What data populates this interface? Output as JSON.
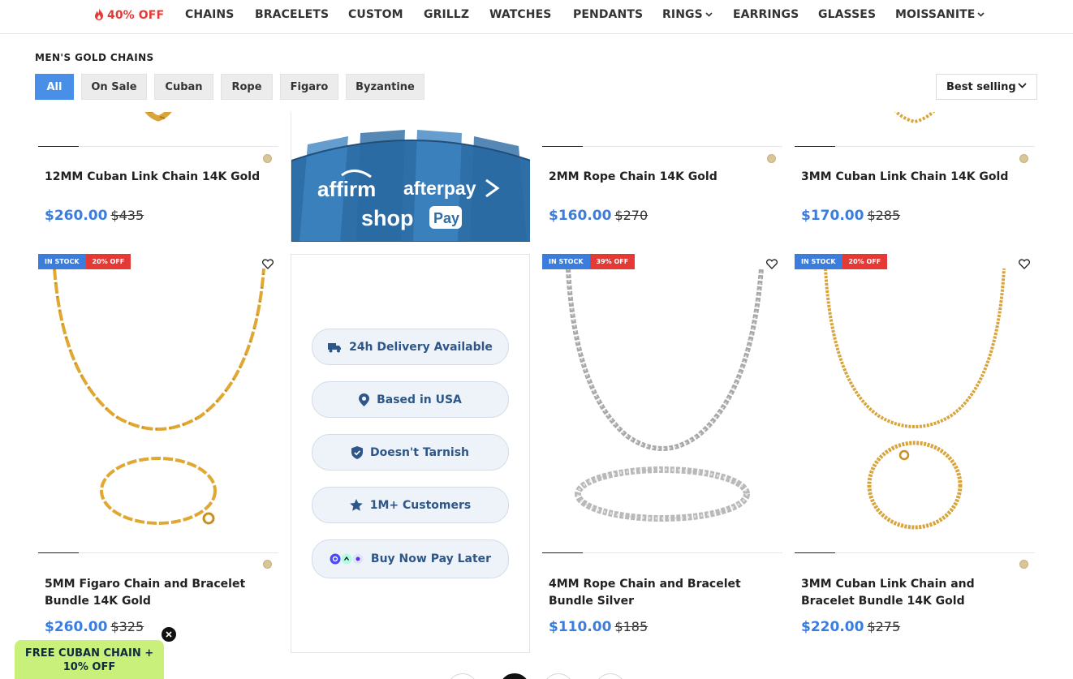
{
  "nav": {
    "promo_label": "40% OFF",
    "items": [
      "CHAINS",
      "BRACELETS",
      "CUSTOM",
      "GRILLZ",
      "WATCHES",
      "PENDANTS",
      "RINGS",
      "EARRINGS",
      "GLASSES",
      "MOISSANITE"
    ]
  },
  "collection": {
    "title": "MEN'S GOLD CHAINS",
    "filters": [
      "All",
      "On Sale",
      "Cuban",
      "Rope",
      "Figaro",
      "Byzantine"
    ],
    "active_filter": "All",
    "sort_label": "Best selling"
  },
  "products": [
    {
      "title": "12MM Cuban Link Chain 14K Gold",
      "price": "$260.00",
      "compare": "$435"
    },
    {
      "title": "2MM Rope Chain 14K Gold",
      "price": "$160.00",
      "compare": "$270"
    },
    {
      "title": "3MM Cuban Link Chain 14K Gold",
      "price": "$170.00",
      "compare": "$285"
    },
    {
      "title": "5MM Figaro Chain and Bracelet Bundle 14K Gold",
      "price": "$260.00",
      "compare": "$325",
      "stock": "IN STOCK",
      "discount": "20% OFF"
    },
    {
      "title": "4MM Rope Chain and Bracelet Bundle Silver",
      "price": "$110.00",
      "compare": "$185",
      "stock": "IN STOCK",
      "discount": "39% OFF"
    },
    {
      "title": "3MM Cuban Link Chain and Bracelet Bundle 14K Gold",
      "price": "$220.00",
      "compare": "$275",
      "stock": "IN STOCK",
      "discount": "20% OFF"
    }
  ],
  "payment_banner": {
    "affirm": "affirm",
    "afterpay": "afterpay",
    "shop": "shop",
    "pay": "Pay"
  },
  "features": [
    "24h Delivery Available",
    "Based in USA",
    "Doesn't Tarnish",
    "1M+ Customers",
    "Buy Now Pay Later"
  ],
  "promo": {
    "line1": "FREE CUBAN CHAIN +",
    "line2": "10% OFF"
  },
  "colors": {
    "accent": "#3b7ddd",
    "sale_red": "#e53935",
    "promo_green": "#c8f07a",
    "gold": "#d9a43a",
    "silver": "#b9b9b9"
  }
}
